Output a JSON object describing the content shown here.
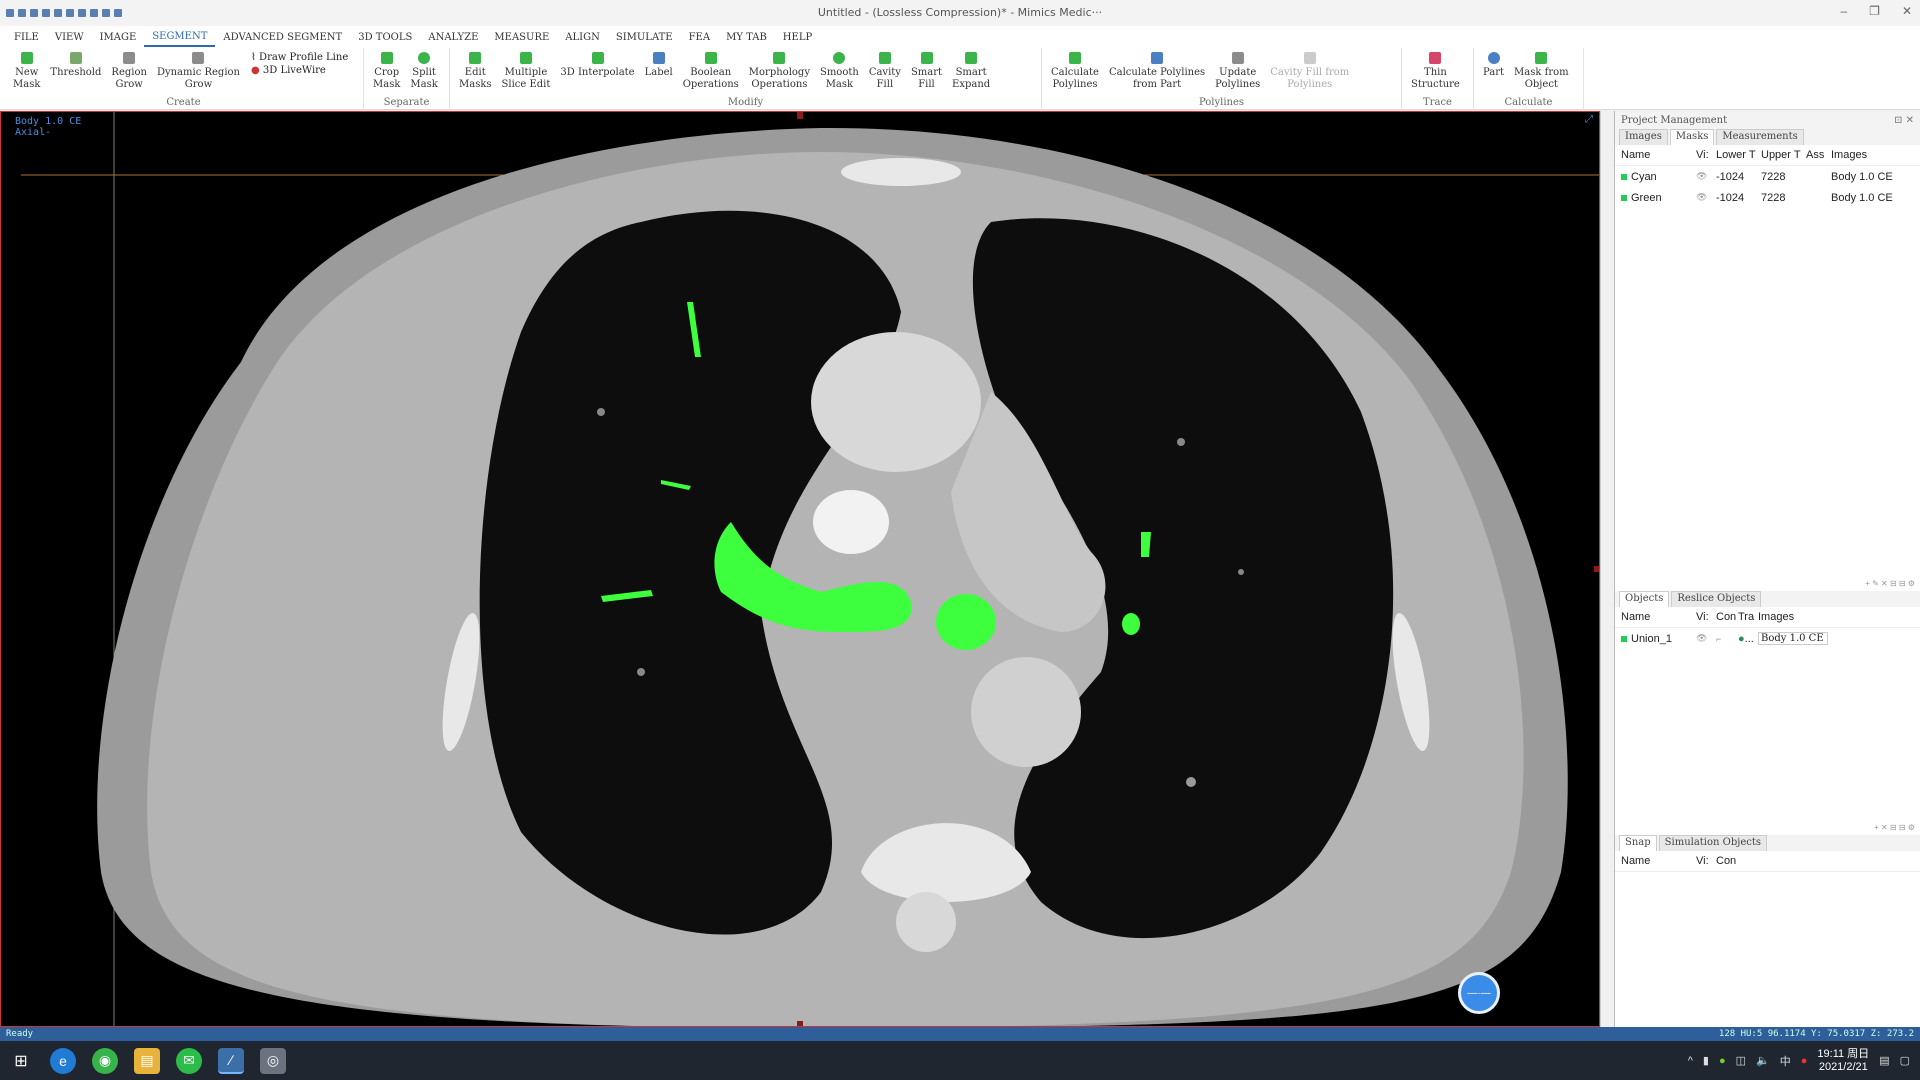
{
  "window": {
    "title": "Untitled -  (Lossless Compression)* - Mimics Medic···"
  },
  "menu": [
    "FILE",
    "VIEW",
    "IMAGE",
    "SEGMENT",
    "ADVANCED SEGMENT",
    "3D TOOLS",
    "ANALYZE",
    "MEASURE",
    "ALIGN",
    "SIMULATE",
    "FEA",
    "MY TAB",
    "HELP"
  ],
  "ribbon": {
    "create": {
      "label": "Create",
      "new_mask": "New\nMask",
      "threshold": "Threshold",
      "region_grow": "Region\nGrow",
      "dynamic_region_grow": "Dynamic Region\nGrow",
      "draw_profile_line": "Draw Profile Line",
      "livewire": "3D LiveWire"
    },
    "separate": {
      "label": "Separate",
      "crop_mask": "Crop\nMask",
      "split_mask": "Split\nMask"
    },
    "modify": {
      "label": "Modify",
      "edit_masks": "Edit\nMasks",
      "multiple_slice_edit": "Multiple\nSlice Edit",
      "interpolate": "3D Interpolate",
      "label_btn": "Label",
      "boolean_ops": "Boolean\nOperations",
      "morphology_ops": "Morphology\nOperations",
      "smooth_mask": "Smooth\nMask",
      "cavity_fill": "Cavity\nFill",
      "smart_fill": "Smart\nFill",
      "smart_expand": "Smart\nExpand"
    },
    "polylines": {
      "label": "Polylines",
      "calc_polylines": "Calculate\nPolylines",
      "calc_polylines_part": "Calculate Polylines\nfrom Part",
      "update_polylines": "Update\nPolylines",
      "cavity_fill_polylines": "Cavity Fill from\nPolylines"
    },
    "trace": {
      "label": "Trace",
      "thin_structure": "Thin\nStructure"
    },
    "calculate": {
      "label": "Calculate",
      "part": "Part",
      "mask_from_object": "Mask from\nObject"
    }
  },
  "viewport": {
    "name": "Body 1.0 CE",
    "view": "Axial-"
  },
  "project_management": {
    "title": "Project Management",
    "tabs": [
      "Images",
      "Masks",
      "Measurements"
    ],
    "columns": [
      "Name",
      "Vi:",
      "Lower T",
      "Upper T",
      "Ass",
      "Images"
    ],
    "rows": [
      {
        "name": "Cyan",
        "lower": "-1024",
        "upper": "7228",
        "images": "Body 1.0 CE",
        "color": "#22cc55"
      },
      {
        "name": "Green",
        "lower": "-1024",
        "upper": "7228",
        "images": "Body 1.0 CE",
        "color": "#22cc55"
      }
    ]
  },
  "objects": {
    "tabs": [
      "Objects",
      "Reslice Objects"
    ],
    "columns": [
      "Name",
      "Vi:",
      "Con",
      "Tra",
      "Images"
    ],
    "rows": [
      {
        "name": "Union_1",
        "tra": "...",
        "images": "Body 1.0 CE",
        "color": "#22cc55"
      }
    ]
  },
  "simulation": {
    "tabs": [
      "Snap",
      "Simulation Objects"
    ],
    "columns": [
      "Name",
      "Vi:",
      "Con"
    ]
  },
  "status": {
    "left": "Ready",
    "right": "128 HU:5  96.1174 Y: 75.0317 Z: 273.2  "
  },
  "taskbar": {
    "time": "19:11 周日",
    "date": "2021/2/21",
    "ime": "中"
  },
  "colors": {
    "accent": "#2b6cb0",
    "mask": "#3dff3d",
    "status": "#2f5f9a"
  }
}
